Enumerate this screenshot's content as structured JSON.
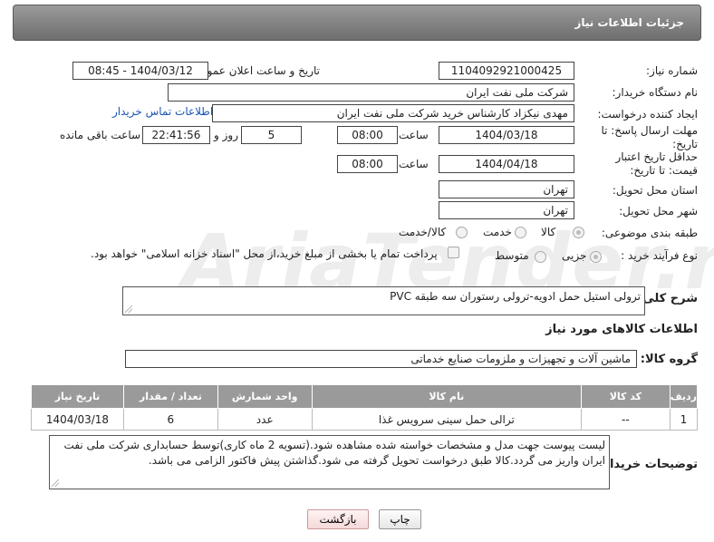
{
  "header": {
    "title": "جزئیات اطلاعات نیاز"
  },
  "fields": {
    "need_number_label": "شماره نیاز:",
    "need_number": "1104092921000425",
    "announce_label": "تاریخ و ساعت اعلان عمومی:",
    "announce_value": "1404/03/12 - 08:45",
    "buyer_org_label": "نام دستگاه خریدار:",
    "buyer_org": "شرکت ملی نفت ایران",
    "requester_label": "ایجاد کننده درخواست:",
    "requester": "مهدی نیکزاد کارشناس خرید شرکت ملی نفت ایران",
    "contact_link": "اطلاعات تماس خریدار",
    "deadline_label": "مهلت ارسال پاسخ: تا تاریخ:",
    "deadline_date": "1404/03/18",
    "time_label": "ساعت",
    "deadline_time": "08:00",
    "days_value": "5",
    "days_label": "روز و",
    "remaining_time": "22:41:56",
    "remaining_label": "ساعت باقی مانده",
    "price_validity_label": "حداقل تاریخ اعتبار قیمت: تا تاریخ:",
    "price_validity_date": "1404/04/18",
    "price_validity_time": "08:00",
    "province_label": "استان محل تحویل:",
    "province": "تهران",
    "city_label": "شهر محل تحویل:",
    "city": "تهران",
    "category_label": "طبقه بندی موضوعی:",
    "category_options": [
      "کالا",
      "خدمت",
      "کالا/خدمت"
    ],
    "process_label": "نوع فرآیند خرید :",
    "process_options": [
      "جزیی",
      "متوسط"
    ],
    "payment_note": "پرداخت تمام یا بخشی از مبلغ خرید،از محل \"اسناد خزانه اسلامی\" خواهد بود."
  },
  "description": {
    "label": "شرح کلی نیاز:",
    "text": "ترولی استیل حمل ادویه-ترولی رستوران سه طبقه PVC"
  },
  "goods": {
    "section_title": "اطلاعات کالاهای مورد نیاز",
    "group_label": "گروه کالا:",
    "group_value": "ماشین آلات و تجهیزات و ملزومات صنایع خدماتی",
    "columns": [
      "ردیف",
      "کد کالا",
      "نام کالا",
      "واحد شمارش",
      "تعداد / مقدار",
      "تاریخ نیاز"
    ],
    "rows": [
      [
        "1",
        "--",
        "ترالی حمل سینی سرویس غذا",
        "عدد",
        "6",
        "1404/03/18"
      ]
    ]
  },
  "buyer_notes": {
    "label": "توضیحات خریدار:",
    "text": "لیست پیوست جهت مدل و مشخصات خواسته شده مشاهده شود.(تسویه 2 ماه کاری)توسط حسابداری شرکت ملی نفت ایران واریز می گردد.کالا طبق درخواست تحویل گرفته می شود.گذاشتن پیش فاکتور الزامی می باشد."
  },
  "buttons": {
    "print": "چاپ",
    "back": "بازگشت"
  },
  "watermark": "AriaTender.neT"
}
